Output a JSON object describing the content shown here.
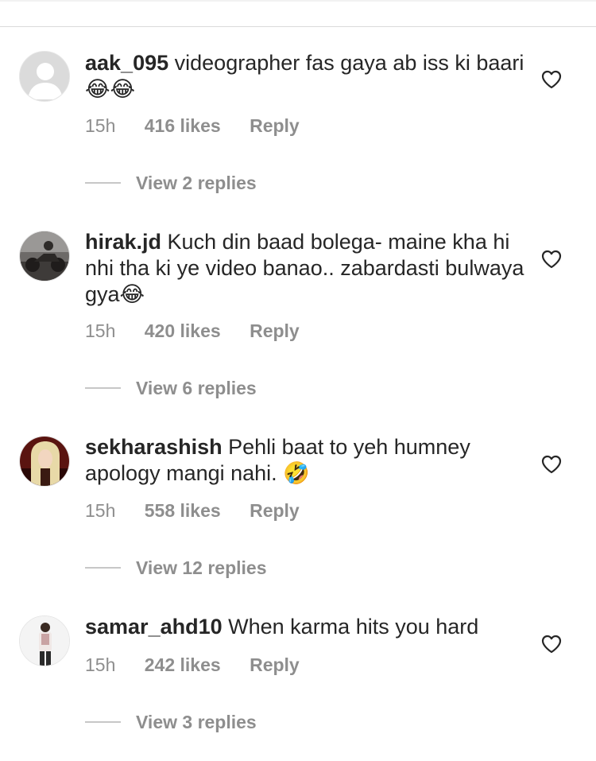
{
  "comments": [
    {
      "username": "aak_095",
      "text": "videographer fas gaya ab iss ki baari",
      "emoji": "😂😂",
      "time": "15h",
      "likes": "416 likes",
      "reply": "Reply",
      "view_replies": "View 2 replies",
      "avatar": "default-avatar-icon"
    },
    {
      "username": "hirak.jd",
      "text": "Kuch din baad bolega- maine kha hi nhi tha ki ye video banao.. zabardasti bulwaya gya",
      "emoji": "😂",
      "time": "15h",
      "likes": "420 likes",
      "reply": "Reply",
      "view_replies": "View 6 replies",
      "avatar": "motorcycle-photo"
    },
    {
      "username": "sekharashish",
      "text": "Pehli baat to yeh humney apology mangi nahi.",
      "emoji": "🤣",
      "time": "15h",
      "likes": "558 likes",
      "reply": "Reply",
      "view_replies": "View 12 replies",
      "avatar": "anime-character-photo"
    },
    {
      "username": "samar_ahd10",
      "text": "When karma hits you hard",
      "emoji": "",
      "time": "15h",
      "likes": "242 likes",
      "reply": "Reply",
      "view_replies": "View 3 replies",
      "avatar": "person-standing-photo"
    }
  ],
  "colors": {
    "text": "#262626",
    "secondary": "#8e8e8e",
    "divider": "#dbdbdb"
  }
}
